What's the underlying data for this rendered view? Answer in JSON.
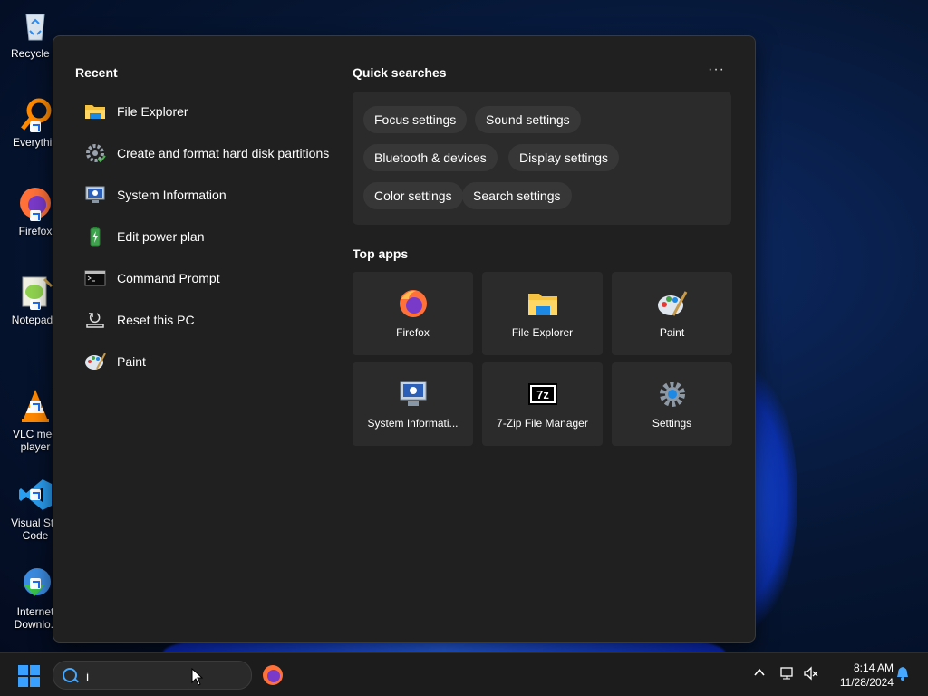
{
  "desktop": {
    "icons": [
      {
        "label": "Recycle B",
        "icon": "recycle-bin-icon"
      },
      {
        "label": "Everythin",
        "icon": "everything-search-icon"
      },
      {
        "label": "Firefox",
        "icon": "firefox-icon"
      },
      {
        "label": "Notepad+",
        "icon": "notepad-plus-plus-icon"
      },
      {
        "label": "VLC med\nplayer",
        "icon": "vlc-icon"
      },
      {
        "label": "Visual Stu\nCode",
        "icon": "vscode-icon"
      },
      {
        "label": "Internet\nDownlo..",
        "icon": "internet-download-manager-icon"
      }
    ]
  },
  "panel": {
    "recent_title": "Recent",
    "recent": [
      {
        "label": "File Explorer",
        "icon": "folder-icon"
      },
      {
        "label": "Create and format hard disk partitions",
        "icon": "gear-check-icon"
      },
      {
        "label": "System Information",
        "icon": "system-information-icon"
      },
      {
        "label": "Edit power plan",
        "icon": "battery-icon"
      },
      {
        "label": "Command Prompt",
        "icon": "terminal-icon"
      },
      {
        "label": "Reset this PC",
        "icon": "reset-pc-icon"
      },
      {
        "label": "Paint",
        "icon": "paint-palette-icon"
      }
    ],
    "quick_title": "Quick searches",
    "more_label": "···",
    "quick_searches": [
      "Focus settings",
      "Sound settings",
      "Bluetooth & devices",
      "Display settings",
      "Color settings",
      "Search settings"
    ],
    "top_apps_title": "Top apps",
    "top_apps": [
      {
        "label": "Firefox",
        "icon": "firefox-icon"
      },
      {
        "label": "File Explorer",
        "icon": "folder-icon"
      },
      {
        "label": "Paint",
        "icon": "paint-palette-icon"
      },
      {
        "label": "System Informati...",
        "icon": "system-information-icon"
      },
      {
        "label": "7-Zip File Manager",
        "icon": "seven-zip-icon"
      },
      {
        "label": "Settings",
        "icon": "gear-icon"
      }
    ]
  },
  "taskbar": {
    "search_value": "i",
    "time": "8:14 AM",
    "date": "11/28/2024"
  },
  "colors": {
    "accent": "#3aa0ff",
    "panel_bg": "#202020",
    "chip_bg": "#373737"
  }
}
